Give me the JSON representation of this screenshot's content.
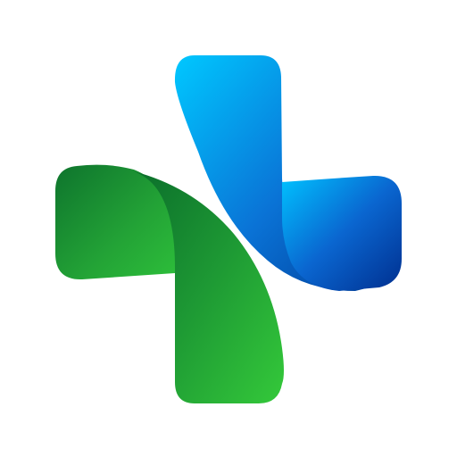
{
  "logo": {
    "name": "medical-cross-logo",
    "description_shape": "stylized two-piece plus sign",
    "colors": {
      "background": "#ffffff",
      "blue_light": "#00C8FF",
      "blue_mid": "#0A73D6",
      "blue_dark": "#003D99",
      "green_light": "#34C93A",
      "green_mid": "#1E9A34",
      "green_dark": "#0B6E2B"
    }
  }
}
